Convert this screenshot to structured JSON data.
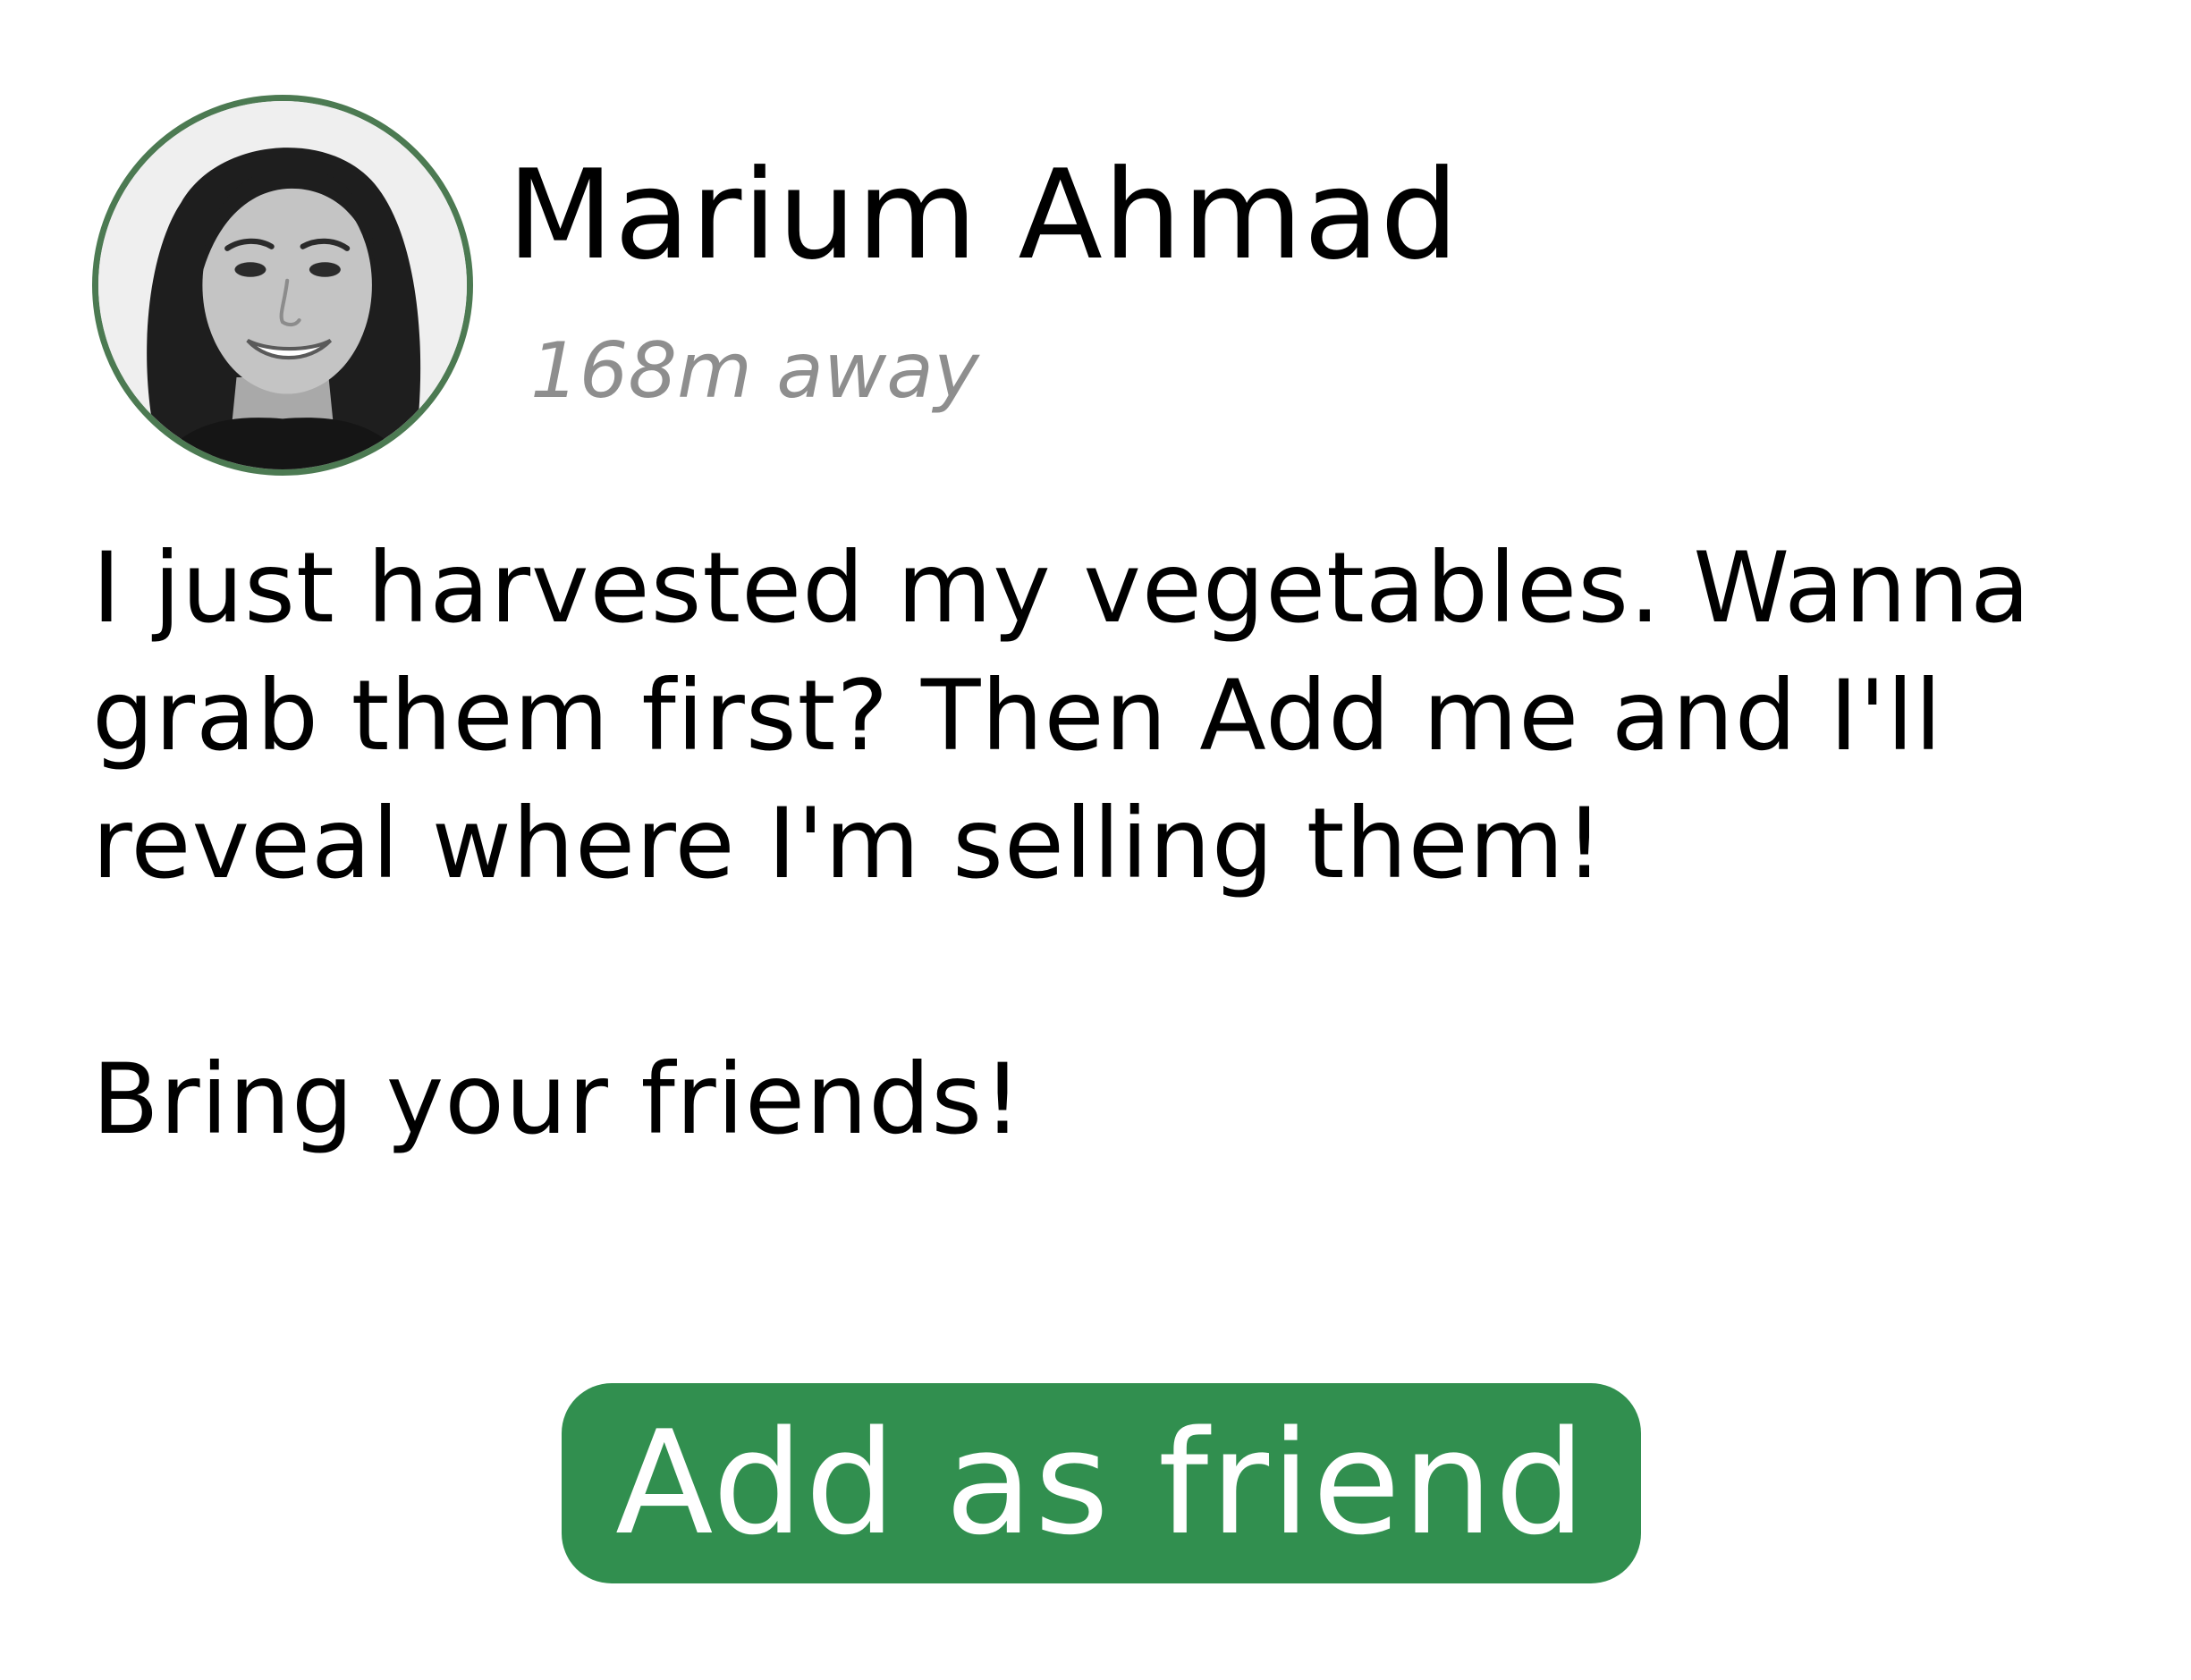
{
  "profile": {
    "name": "Marium Ahmad",
    "distance": "168m away",
    "avatar_alt": "Profile photo of Marium Ahmad"
  },
  "post": {
    "paragraph1": "I just harvested my vegetables. Wanna\ngrab them first? Then Add me and I'll\nreveal where I'm selling them!",
    "paragraph2": "Bring your friends!"
  },
  "actions": {
    "add_friend_label": "Add as friend"
  },
  "colors": {
    "accent": "#318f4f",
    "avatar_ring": "#4c7a52",
    "distance_text": "#8e8e8e",
    "text": "#000000"
  }
}
